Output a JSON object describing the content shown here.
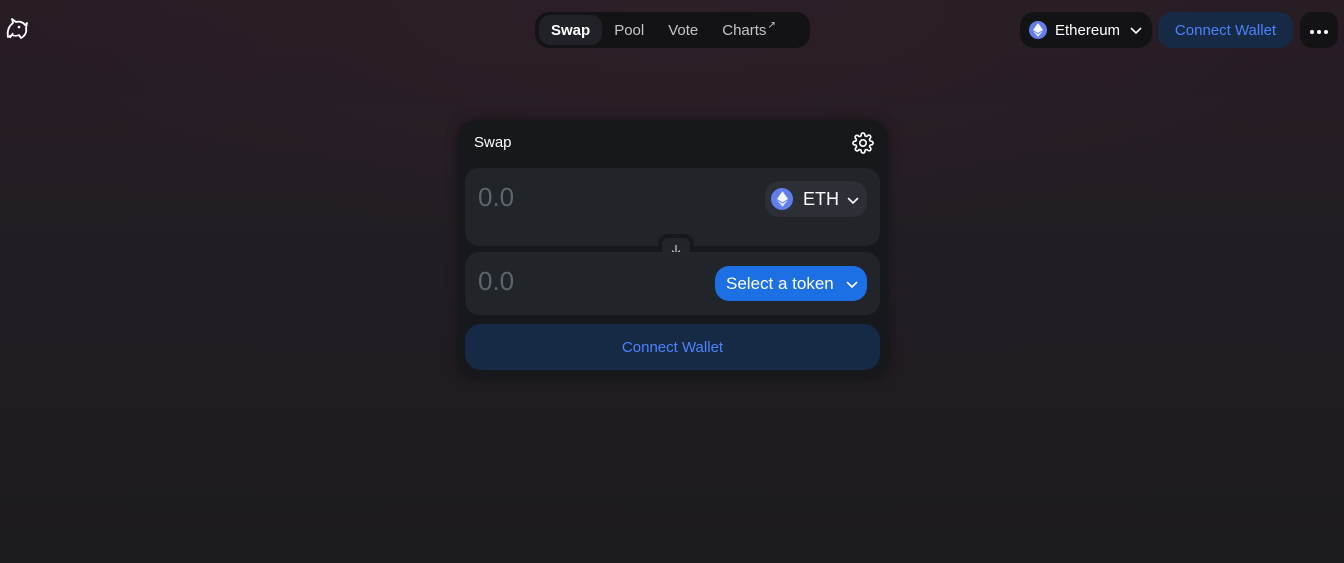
{
  "nav": {
    "items": [
      {
        "label": "Swap",
        "active": true
      },
      {
        "label": "Pool",
        "active": false
      },
      {
        "label": "Vote",
        "active": false
      },
      {
        "label": "Charts",
        "active": false,
        "external": true
      }
    ],
    "external_arrow": "↗"
  },
  "network": {
    "label": "Ethereum"
  },
  "header": {
    "connect_label": "Connect Wallet"
  },
  "swap_card": {
    "title": "Swap",
    "input": {
      "placeholder": "0.0",
      "token": "ETH"
    },
    "output": {
      "placeholder": "0.0",
      "select_label": "Select a token"
    },
    "connect_label": "Connect Wallet"
  },
  "colors": {
    "accent": "#4c82fb",
    "select_button": "#1c70e4",
    "connect_bg": "#172a45",
    "eth": "#627eea"
  },
  "icons": [
    "unicorn-logo-icon",
    "ethereum-icon",
    "chevron-down-icon",
    "more-dots-icon",
    "gear-icon",
    "arrow-down-icon"
  ]
}
